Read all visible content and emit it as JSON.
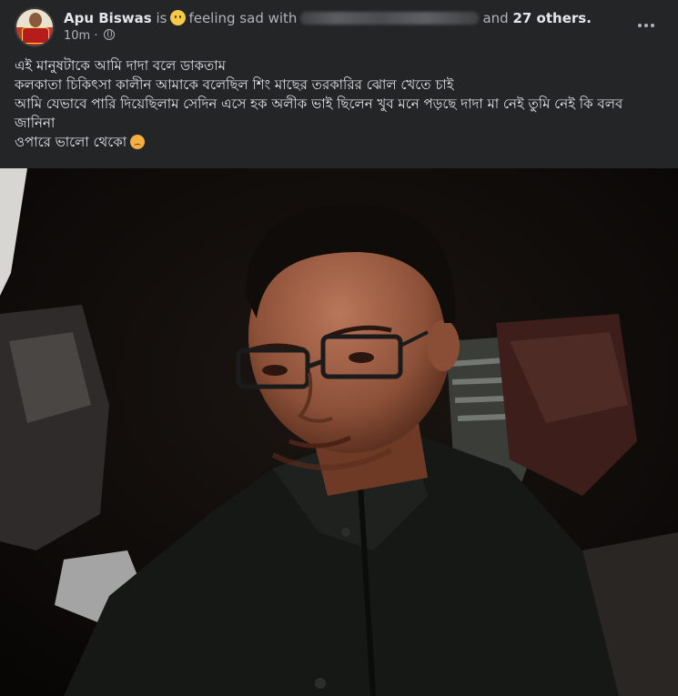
{
  "post": {
    "author_name": "Apu Biswas",
    "connector_is": "is",
    "feeling_icon": "sad-face-icon",
    "feeling_text": "feeling sad with",
    "and_text": "and",
    "others_text": "27 others.",
    "timestamp": "10m",
    "separator": "·",
    "audience_icon": "globe-icon",
    "more_icon": "more-options-icon",
    "text_lines": [
      "এই মানুষটাকে আমি দাদা বলে ডাকতাম",
      "কলকাতা চিকিৎসা কালীন আমাকে বলেছিল শিং মাছের তরকারির ঝোল খেতে চাই",
      "আমি যেভাবে পারি দিয়েছিলাম সেদিন এসে হক অলীক ভাই ছিলেন খুব মনে পড়ছে দাদা মা নেই তুমি নেই কি বলব জানিনা",
      "ওপারে ভালো থেকো"
    ],
    "end_emoji": "sad-emoji-icon"
  },
  "colors": {
    "background": "#242526",
    "primary_text": "#e4e6eb",
    "secondary_text": "#b0b3b8"
  }
}
